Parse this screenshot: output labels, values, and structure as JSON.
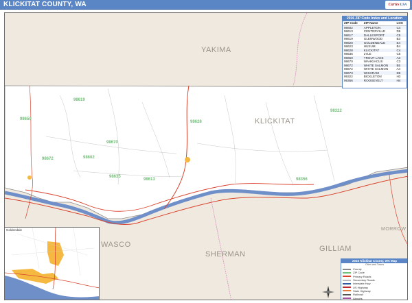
{
  "header": {
    "title": "KLICKITAT COUNTY, WA",
    "logo_main": "Cartes",
    "logo_sub": "USA"
  },
  "colors": {
    "header": "#5b86c6",
    "water": "#6f8fc9",
    "county": "#ffffff",
    "surround": "#efe9df",
    "highway": "#d9442e",
    "zip_label": "#6fbf76",
    "urban": "#f5b942"
  },
  "regions": [
    {
      "name": "YAKIMA"
    },
    {
      "name": "KLICKITAT"
    },
    {
      "name": "SHERMAN"
    },
    {
      "name": "GILLIAM"
    },
    {
      "name": "MORROW"
    },
    {
      "name": "WASCO"
    }
  ],
  "zip_labels": [
    "98619",
    "98650",
    "98628",
    "98670",
    "98602",
    "98672",
    "98635",
    "98613",
    "98322",
    "98356"
  ],
  "zip_table": {
    "title": "2016 ZIP Code Index and Location",
    "headers": [
      "ZIP Code",
      "ZIP Name",
      "LOC"
    ],
    "rows": [
      [
        "98602",
        "APPLETON",
        "C4"
      ],
      [
        "98613",
        "CENTERVILLE",
        "D5"
      ],
      [
        "98617",
        "DALLESPORT",
        "C5"
      ],
      [
        "98619",
        "GLENWOOD",
        "B3"
      ],
      [
        "98620",
        "GOLDENDALE",
        "E4"
      ],
      [
        "98623",
        "HUSUM",
        "B4"
      ],
      [
        "98628",
        "KLICKITAT",
        "C4"
      ],
      [
        "98635",
        "LYLE",
        "C5"
      ],
      [
        "98650",
        "TROUT LAKE",
        "A3"
      ],
      [
        "98670",
        "WAHKIACUS",
        "C3"
      ],
      [
        "98672",
        "WHITE SALMON",
        "B5"
      ],
      [
        "98672",
        "WHITE SALMON",
        "A4"
      ],
      [
        "98673",
        "WISHRAM",
        "D5"
      ],
      [
        "99322",
        "BICKLETON",
        "H3"
      ],
      [
        "99356",
        "ROOSEVELT",
        "H4"
      ]
    ]
  },
  "legend": {
    "title": "2016 Klickitat County, WA Map",
    "subtitle": "Cities and Towns",
    "rows": [
      "County",
      "ZIP Code",
      "Primary Roads",
      "Secondary Roads",
      "Interstate Hwy",
      "US Highway",
      "State Highway",
      "Railroad",
      "Airports"
    ]
  },
  "inset": {
    "title": "Goldendale"
  }
}
